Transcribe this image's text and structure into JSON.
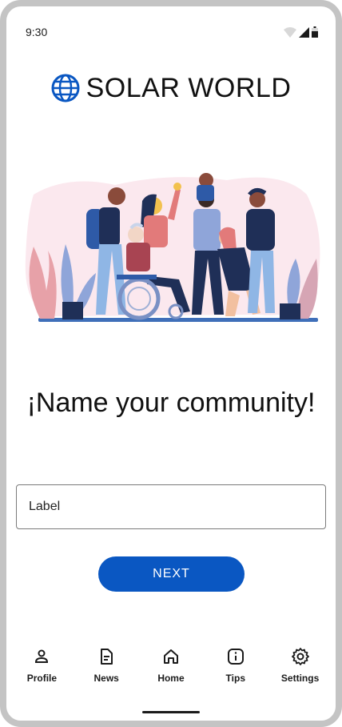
{
  "status_bar": {
    "time": "9:30"
  },
  "app": {
    "title": "SOLAR WORLD",
    "logo_icon": "globe-icon"
  },
  "main": {
    "headline": "¡Name your community!",
    "input": {
      "placeholder": "Label",
      "value": ""
    },
    "next_label": "NEXT"
  },
  "nav": {
    "items": [
      {
        "label": "Profile",
        "icon": "person-icon"
      },
      {
        "label": "News",
        "icon": "document-icon"
      },
      {
        "label": "Home",
        "icon": "home-icon"
      },
      {
        "label": "Tips",
        "icon": "info-icon"
      },
      {
        "label": "Settings",
        "icon": "gear-icon"
      }
    ]
  },
  "colors": {
    "accent": "#0a57c2",
    "text": "#111111",
    "border": "#7a7a7a"
  }
}
